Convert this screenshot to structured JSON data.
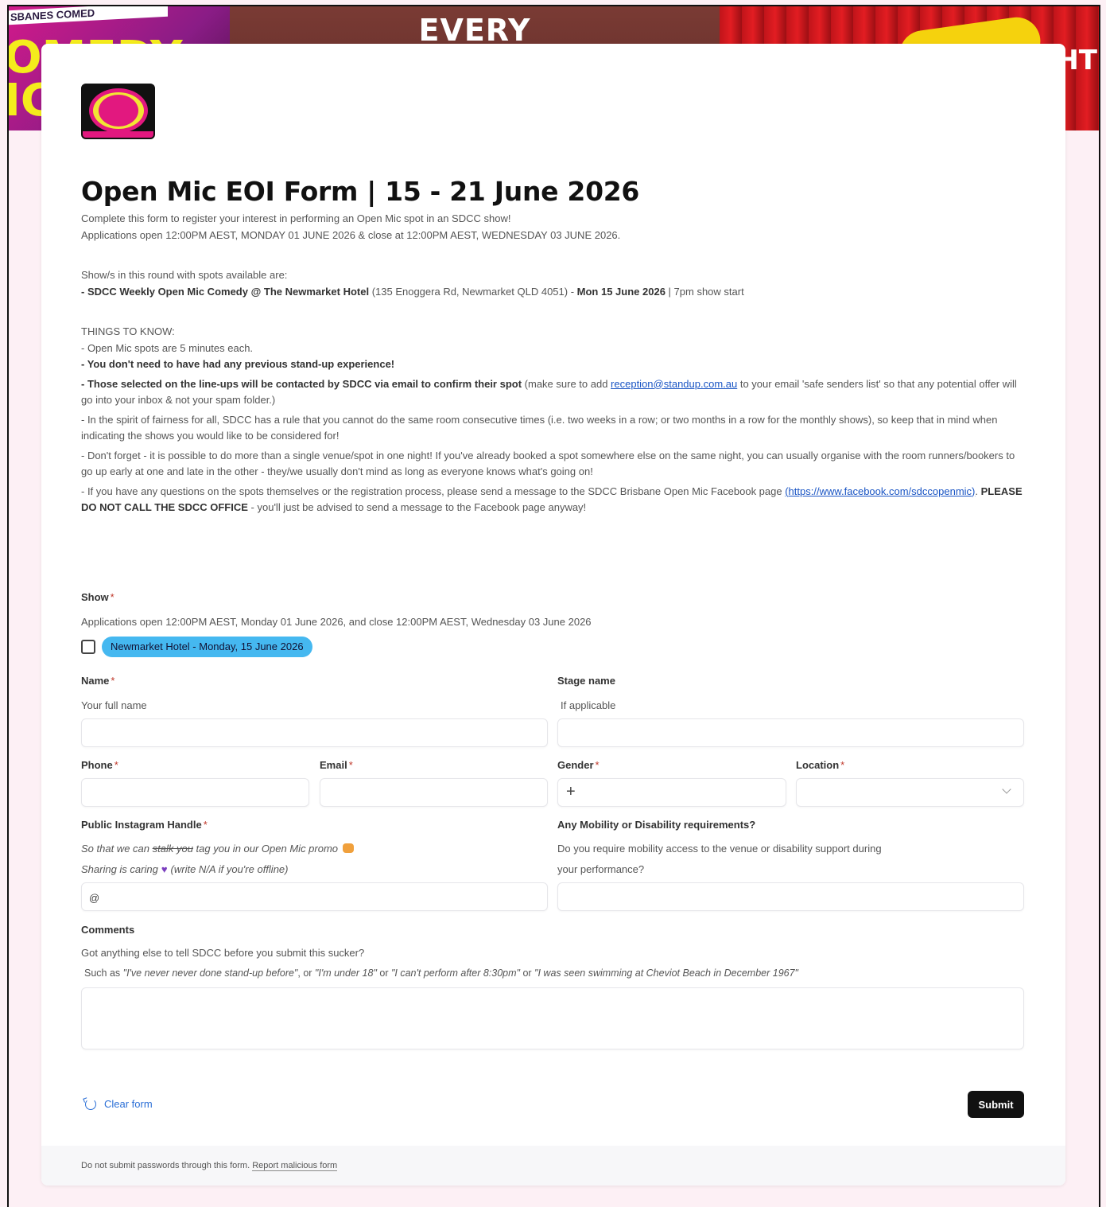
{
  "banner": {
    "left_tag": "SBANES COMED",
    "left_big": "OMEDY IC",
    "center_text": "EVERY",
    "right_text": "HT"
  },
  "form": {
    "title": "Open Mic EOI Form | 15 - 21 June 2026",
    "intro_line1": "Complete this form to register your interest in performing an Open Mic spot in an SDCC show!",
    "intro_line2": "Applications open 12:00PM AEST, MONDAY 01 JUNE 2026 & close at 12:00PM AEST, WEDNESDAY 03 JUNE 2026.",
    "shows_heading": "Show/s in this round with spots available are:",
    "show_line_bold": "- SDCC Weekly Open Mic Comedy @ The Newmarket Hotel",
    "show_line_addr": " (135 Enoggera Rd, Newmarket QLD 4051) - ",
    "show_line_date": "Mon 15 June 2026",
    "show_line_end": " | 7pm show start",
    "things_heading": "THINGS TO KNOW:",
    "thing1": "- Open Mic spots are 5 minutes each.",
    "thing2": "- You don't need to have had any previous stand-up experience!",
    "thing3_bold": "- Those selected on the line-ups will be contacted by SDCC via email to confirm their spot",
    "thing3_a": " (make sure to add ",
    "thing3_link": "reception@standup.com.au",
    "thing3_b": " to your email 'safe senders list' so that any potential offer will go into your inbox & not your spam folder.)",
    "thing4": "- In the spirit of fairness for all, SDCC has a rule that you cannot do the same room consecutive times (i.e. two weeks in a row; or two months in a row for the monthly shows), so keep that in mind when indicating the shows you would like to be considered for!",
    "thing5": "- Don't forget - it is possible to do more than a single venue/spot in one night! If you've already booked a spot somewhere else on the same night, you can usually organise with the room runners/bookers to go up early at one and late in the other - they/we usually don't mind as long as everyone knows what's going on!",
    "thing6_a": "- If you have any questions on the spots themselves or the registration process, please send a message to the SDCC Brisbane Open Mic Facebook page ",
    "thing6_link": "(https://www.facebook.com/sdccopenmic)",
    "thing6_b": ". ",
    "thing6_bold": "PLEASE DO NOT CALL THE SDCC OFFICE",
    "thing6_c": " - you'll just be advised to send a message to the Facebook page anyway!"
  },
  "fields": {
    "show_label": "Show",
    "show_helper": "Applications open 12:00PM AEST, Monday 01 June 2026, and close 12:00PM AEST, Wednesday 03 June 2026",
    "show_option": "Newmarket Hotel - Monday, 15 June 2026",
    "name_label": "Name",
    "name_helper": "Your full name",
    "stage_label": "Stage name",
    "stage_helper": "If applicable",
    "phone_label": "Phone",
    "email_label": "Email",
    "gender_label": "Gender",
    "location_label": "Location",
    "insta_label": "Public Instagram Handle",
    "insta_helper1_a": "So that we can ",
    "insta_helper1_strike": "stalk you",
    "insta_helper1_b": " tag you in our Open Mic promo",
    "insta_helper2_a": "Sharing is caring",
    "insta_helper2_b": "(write N/A if you're offline)",
    "insta_prefix": "@",
    "mobility_label": "Any Mobility or Disability requirements?",
    "mobility_helper1": "Do you require mobility access to the venue or disability support during",
    "mobility_helper2": "your performance?",
    "comments_label": "Comments",
    "comments_helper1": "Got anything else to tell SDCC before you submit this sucker?",
    "comments_ex_a": "Such as ",
    "comments_ex_1": "\"I've never never done stand-up before\"",
    "comments_ex_or1": ", or ",
    "comments_ex_2": "\"I'm under 18\"",
    "comments_ex_or2": " or ",
    "comments_ex_3": "\"I can't perform after 8:30pm\"",
    "comments_ex_or3": " or ",
    "comments_ex_4": "\"I was seen swimming at Cheviot Beach in December 1967\"",
    "required_mark": "*"
  },
  "actions": {
    "clear_label": "Clear form",
    "submit_label": "Submit"
  },
  "footer": {
    "text": "Do not submit passwords through this form. ",
    "report": "Report malicious form"
  },
  "colors": {
    "chip": "#45b8f0",
    "accent_link": "#2b6fd6",
    "required": "#c0392b"
  }
}
